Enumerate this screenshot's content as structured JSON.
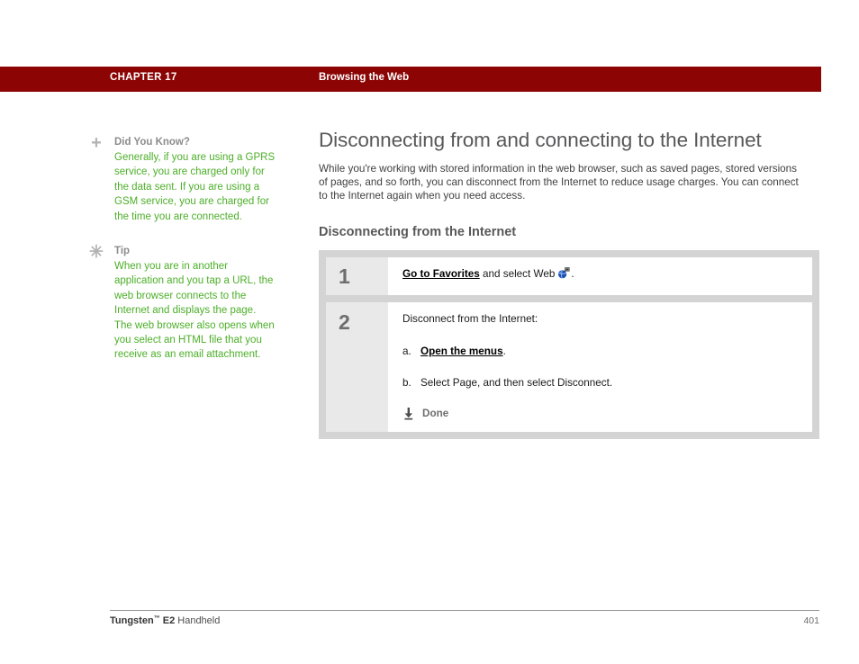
{
  "header": {
    "chapter_label": "CHAPTER 17",
    "chapter_topic": "Browsing the Web",
    "bar_color": "#8c0404"
  },
  "notes": [
    {
      "icon": "plus-icon",
      "glyph": "+",
      "title": "Did You Know?",
      "body": "Generally, if you are using a GPRS service, you are charged only for the data sent. If you are using a GSM service, you are charged for the time you are connected.",
      "title_color": "#8c8c8c",
      "body_color": "#4caf28"
    },
    {
      "icon": "asterisk-icon",
      "glyph": "✳",
      "title": "Tip",
      "body": "When you are in another application and you tap a URL, the web browser connects to the Internet and displays the page. The web browser also opens when you select an HTML file that you receive as an email attachment.",
      "title_color": "#8c8c8c",
      "body_color": "#4caf28"
    }
  ],
  "main": {
    "title": "Disconnecting from and connecting to the Internet",
    "intro": "While you're working with stored information in the web browser, such as saved pages, stored versions of pages, and so forth, you can disconnect from the Internet to reduce usage charges. You can connect to the Internet again when you need access.",
    "section_title": "Disconnecting from the Internet",
    "steps": [
      {
        "number": "1",
        "xref": "Go to Favorites",
        "text_after": " and select Web",
        "icon": "web-app-icon",
        "text_end": "."
      },
      {
        "number": "2",
        "lead": "Disconnect from the Internet:",
        "substeps": [
          {
            "marker": "a.",
            "xref": "Open the menus",
            "text_after": "."
          },
          {
            "marker": "b.",
            "xref": "",
            "text_after": "Select Page, and then select Disconnect."
          }
        ],
        "done_label": "Done",
        "done_icon": "download-arrow-icon"
      }
    ]
  },
  "footer": {
    "product": "Tungsten",
    "trademark": "™",
    "model": " E2",
    "device": " Handheld",
    "page_number": "401"
  }
}
